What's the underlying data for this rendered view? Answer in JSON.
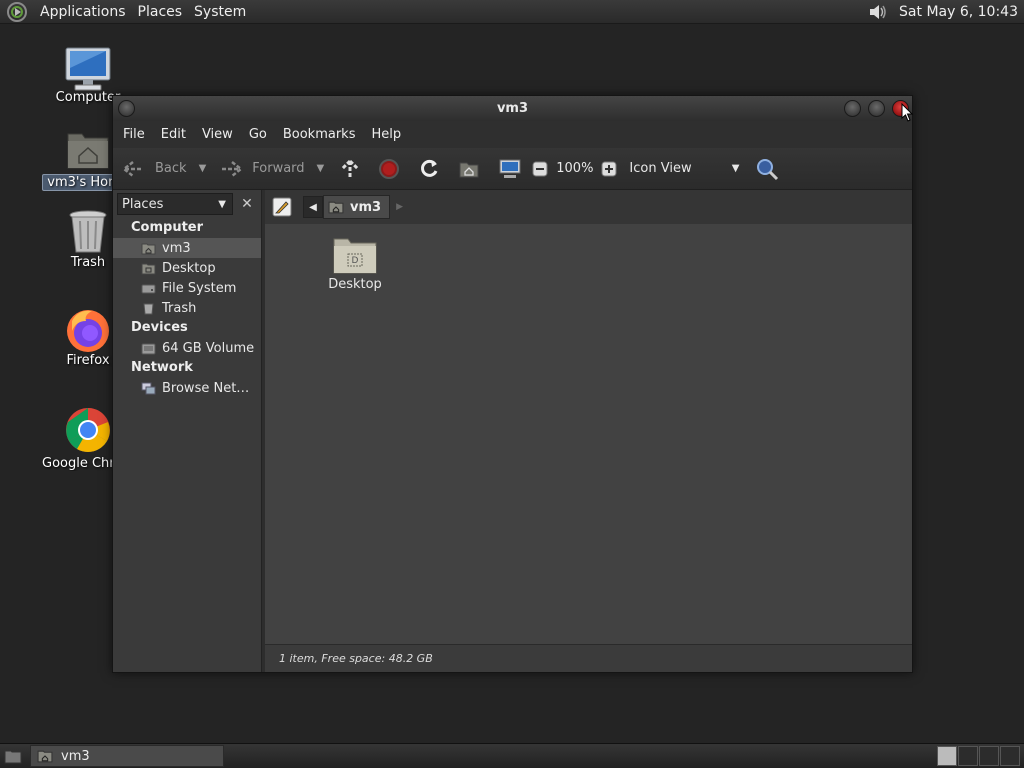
{
  "top_panel": {
    "menus": [
      "Applications",
      "Places",
      "System"
    ],
    "clock": "Sat May  6, 10:43"
  },
  "desktop_icons": [
    {
      "label": "Computer",
      "icon": "computer-icon"
    },
    {
      "label": "vm3's Home",
      "icon": "home-folder-icon"
    },
    {
      "label": "Trash",
      "icon": "trash-icon"
    },
    {
      "label": "Firefox",
      "icon": "firefox-icon"
    },
    {
      "label": "Google Chrome",
      "icon": "chrome-icon"
    }
  ],
  "window": {
    "title": "vm3",
    "menubar": [
      "File",
      "Edit",
      "View",
      "Go",
      "Bookmarks",
      "Help"
    ],
    "toolbar": {
      "back": "Back",
      "forward": "Forward",
      "zoom": "100%",
      "view_mode": "Icon View"
    },
    "sidebar": {
      "combo_label": "Places",
      "sections": [
        {
          "heading": "Computer",
          "items": [
            "vm3",
            "Desktop",
            "File System",
            "Trash"
          ]
        },
        {
          "heading": "Devices",
          "items": [
            "64 GB Volume"
          ]
        },
        {
          "heading": "Network",
          "items": [
            "Browse Net…"
          ]
        }
      ],
      "selected": "vm3"
    },
    "path": {
      "current": "vm3"
    },
    "files": [
      {
        "name": "Desktop",
        "icon": "desktop-folder-icon"
      }
    ],
    "status": "1 item, Free space: 48.2 GB"
  },
  "bottom_panel": {
    "task": "vm3"
  },
  "colors": {
    "desktop": "#242424",
    "close_button": "#d03030",
    "content_bg": "#424242"
  }
}
